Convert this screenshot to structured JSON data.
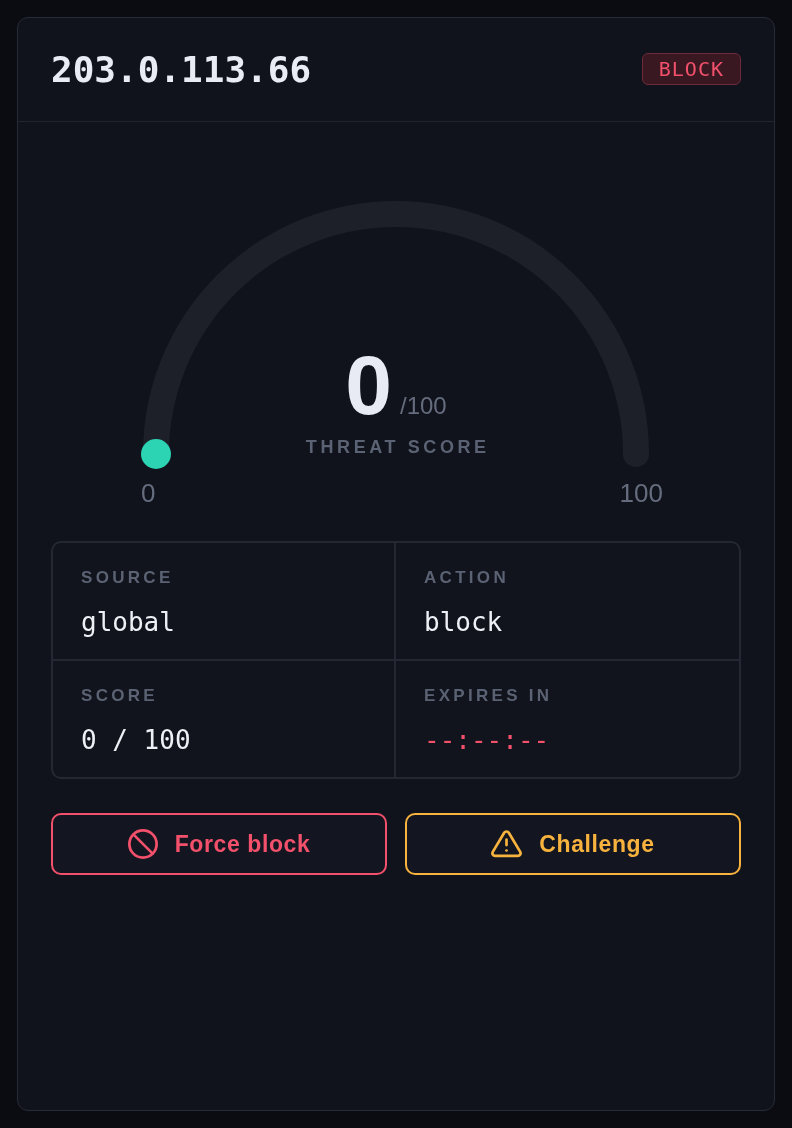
{
  "header": {
    "ip_address": "203.0.113.66",
    "badge": {
      "label": "BLOCK",
      "kind": "block"
    }
  },
  "gauge": {
    "value": "0",
    "max": "/100",
    "label": "THREAT SCORE",
    "level": 0,
    "scale_min": "0",
    "scale_max": "100"
  },
  "details": [
    {
      "label": "SOURCE",
      "value": "global",
      "kind": "text"
    },
    {
      "label": "ACTION",
      "value": "block",
      "kind": "text"
    },
    {
      "label": "SCORE",
      "value": "0 / 100",
      "kind": "text"
    },
    {
      "label": "EXPIRES IN",
      "value": "--:--:--",
      "kind": "timer"
    }
  ],
  "buttons": [
    {
      "label": "Force block",
      "kind": "danger"
    },
    {
      "label": "Challenge",
      "kind": "warning"
    }
  ]
}
